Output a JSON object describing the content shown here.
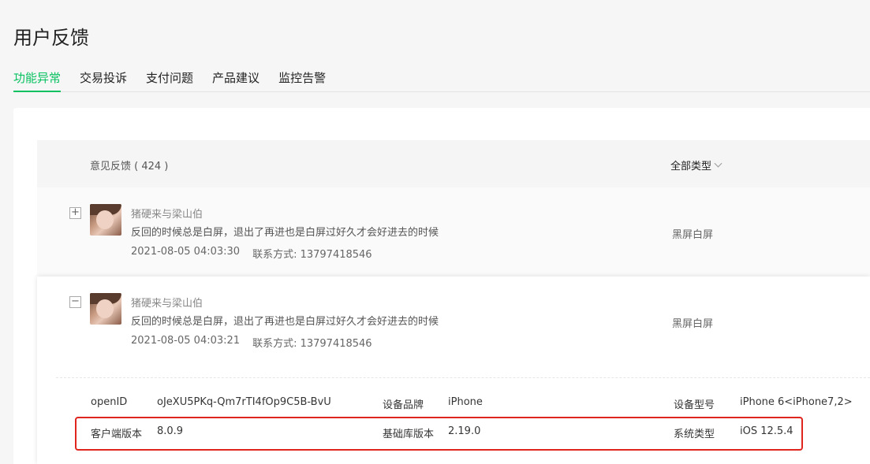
{
  "page": {
    "title": "用户反馈"
  },
  "tabs": [
    {
      "label": "功能异常",
      "active": true
    },
    {
      "label": "交易投诉",
      "active": false
    },
    {
      "label": "支付问题",
      "active": false
    },
    {
      "label": "产品建议",
      "active": false
    },
    {
      "label": "监控告警",
      "active": false
    }
  ],
  "list": {
    "header_title": "意见反馈 ( 424 )",
    "type_filter": "全部类型"
  },
  "rows": [
    {
      "toggle": "+",
      "username": "猪硬来与梁山伯",
      "content": "反回的时候总是白屏，退出了再进也是白屏过好久才会好进去的时候",
      "time": "2021-08-05 04:03:30",
      "contact": "联系方式: 13797418546",
      "category": "黑屏白屏"
    },
    {
      "toggle": "−",
      "username": "猪硬来与梁山伯",
      "content": "反回的时候总是白屏，退出了再进也是白屏过好久才会好进去的时候",
      "time": "2021-08-05 04:03:21",
      "contact": "联系方式: 13797418546",
      "category": "黑屏白屏",
      "details": {
        "openid_label": "openID",
        "openid_value": "oJeXU5PKq-Qm7rTI4fOp9C5B-BvU",
        "brand_label": "设备品牌",
        "brand_value": "iPhone",
        "model_label": "设备型号",
        "model_value": "iPhone 6<iPhone7,2>",
        "client_label": "客户端版本",
        "client_value": "8.0.9",
        "lib_label": "基础库版本",
        "lib_value": "2.19.0",
        "os_label": "系统类型",
        "os_value": "iOS 12.5.4"
      }
    }
  ],
  "colors": {
    "accent": "#07c160",
    "highlight": "#e0241e"
  }
}
